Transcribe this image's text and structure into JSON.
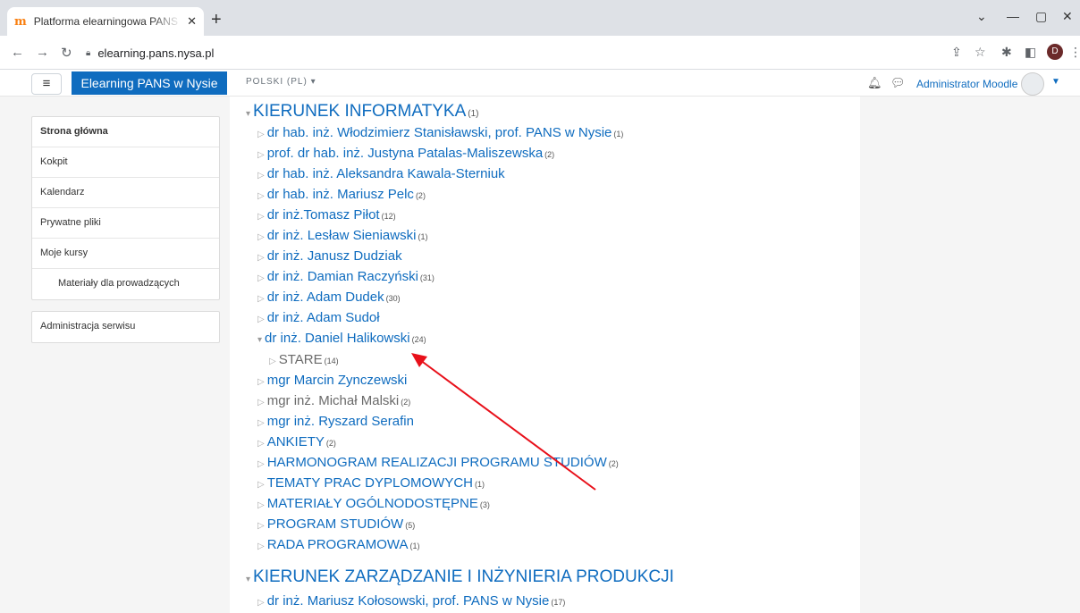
{
  "browser": {
    "tab_title": "Platforma elearningowa PANS w Nysie",
    "favicon": "moodle-icon",
    "url": "elearning.pans.nysa.pl",
    "profile_initial": "D"
  },
  "navbar": {
    "brand": "Elearning PANS w Nysie",
    "language": "POLSKI (PL) ▾",
    "user_name": "Administrator Moodle"
  },
  "sidebar": {
    "items": [
      {
        "label": "Strona główna"
      },
      {
        "label": "Kokpit"
      },
      {
        "label": "Kalendarz"
      },
      {
        "label": "Prywatne pliki"
      },
      {
        "label": "Moje kursy"
      },
      {
        "label": "Materiały dla prowadzących"
      }
    ],
    "admin": "Administracja serwisu"
  },
  "categories": [
    {
      "label": "KIERUNEK INFORMATYKA",
      "count": "(1)"
    },
    {
      "label": "dr hab. inż. Włodzimierz Stanisławski, prof. PANS w Nysie",
      "count": "(1)"
    },
    {
      "label": "prof. dr hab. inż. Justyna Patalas-Maliszewska",
      "count": "(2)"
    },
    {
      "label": "dr hab. inż. Aleksandra Kawala-Sterniuk",
      "count": ""
    },
    {
      "label": "dr hab. inż. Mariusz Pelc",
      "count": "(2)"
    },
    {
      "label": "dr inż.Tomasz Piłot",
      "count": "(12)"
    },
    {
      "label": "dr inż. Lesław Sieniawski",
      "count": "(1)"
    },
    {
      "label": "dr inż. Janusz Dudziak",
      "count": ""
    },
    {
      "label": "dr inż. Damian Raczyński",
      "count": "(31)"
    },
    {
      "label": "dr inż. Adam Dudek",
      "count": "(30)"
    },
    {
      "label": "dr inż. Adam Sudoł",
      "count": ""
    },
    {
      "label": "dr inż. Daniel Halikowski",
      "count": "(24)"
    },
    {
      "label": "STARE",
      "count": "(14)"
    },
    {
      "label": "mgr Marcin Zynczewski",
      "count": ""
    },
    {
      "label": "mgr inż. Michał Malski",
      "count": "(2)"
    },
    {
      "label": "mgr inż. Ryszard Serafin",
      "count": ""
    },
    {
      "label": "ANKIETY",
      "count": "(2)"
    },
    {
      "label": "HARMONOGRAM REALIZACJI PROGRAMU STUDIÓW",
      "count": "(2)"
    },
    {
      "label": "TEMATY PRAC DYPLOMOWYCH",
      "count": "(1)"
    },
    {
      "label": "MATERIAŁY OGÓLNODOSTĘPNE",
      "count": "(3)"
    },
    {
      "label": "PROGRAM STUDIÓW",
      "count": "(5)"
    },
    {
      "label": "RADA PROGRAMOWA",
      "count": "(1)"
    },
    {
      "label": "KIERUNEK ZARZĄDZANIE I INŻYNIERIA PRODUKCJI",
      "count": ""
    },
    {
      "label": "dr inż. Mariusz Kołosowski, prof. PANS w Nysie",
      "count": "(17)"
    }
  ],
  "annotation_color": "#e8101a"
}
